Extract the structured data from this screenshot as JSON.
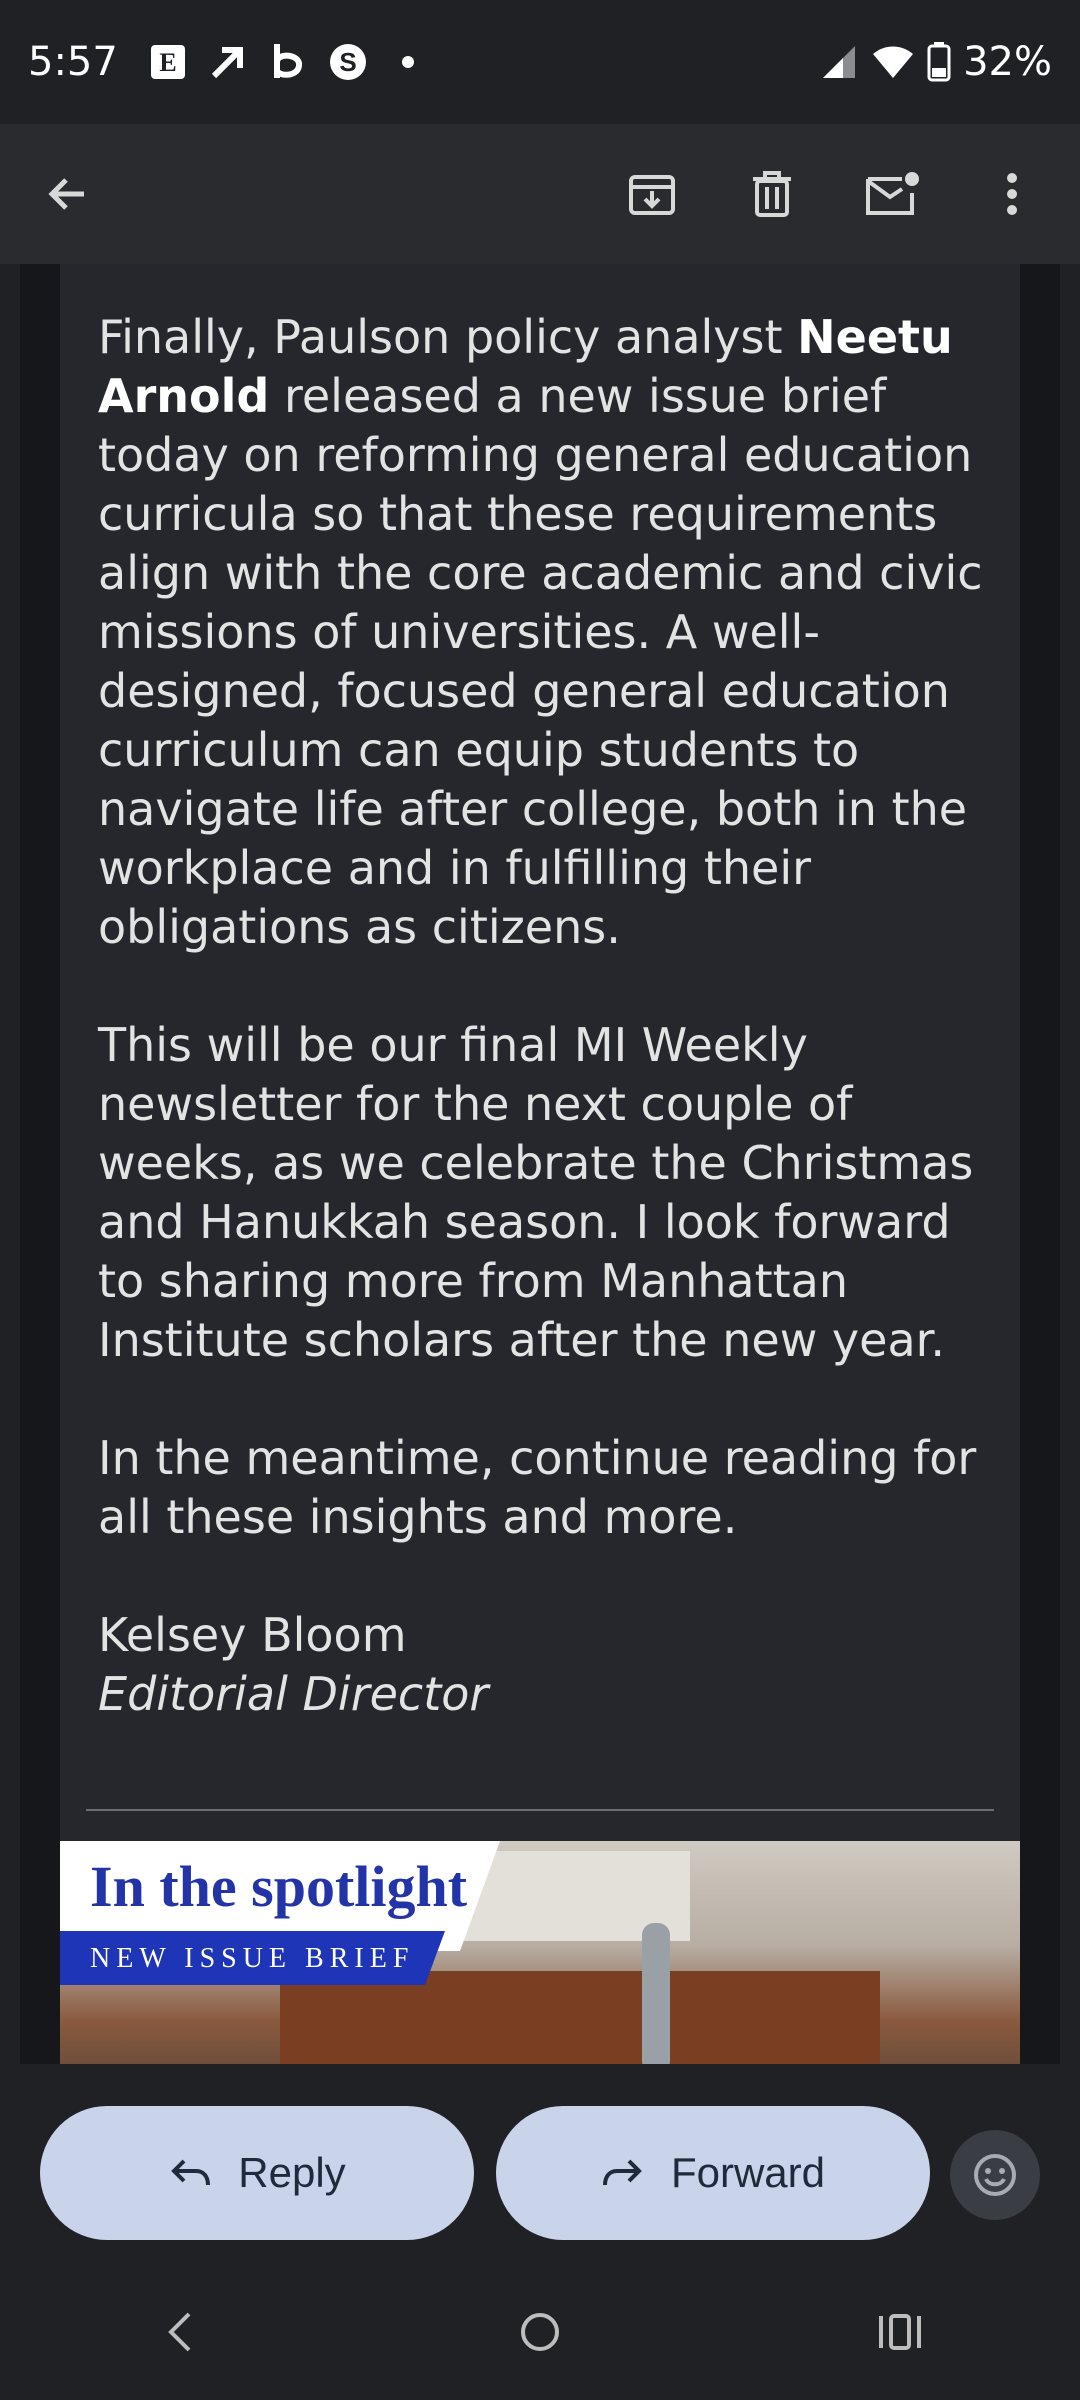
{
  "status": {
    "time": "5:57",
    "battery": "32%",
    "icons": [
      "E",
      "arrow-icon",
      "b-icon",
      "s-icon",
      "dot-icon"
    ]
  },
  "email": {
    "p1_pre": "Finally, Paulson policy analyst ",
    "p1_name": "Neetu Arnold",
    "p1_post": " released a new issue brief today on reforming general education curricula so that these requirements align with the core academic and civic missions of universities. A well-designed, focused general education curriculum can equip students to navigate life after college, both in the workplace and in fulfilling their obligations as citizens.",
    "p2": "This will be our final MI Weekly newsletter for the next couple of weeks, as we celebrate the Christmas and Hanukkah season. I look forward to sharing more from Manhattan Institute scholars after the new year.",
    "p3": "In the meantime, continue reading for all these insights and more.",
    "signature_name": "Kelsey Bloom",
    "signature_title": "Editorial Director"
  },
  "banner": {
    "title": "In the spotlight",
    "subtitle": "NEW ISSUE BRIEF"
  },
  "actions": {
    "reply": "Reply",
    "forward": "Forward"
  }
}
